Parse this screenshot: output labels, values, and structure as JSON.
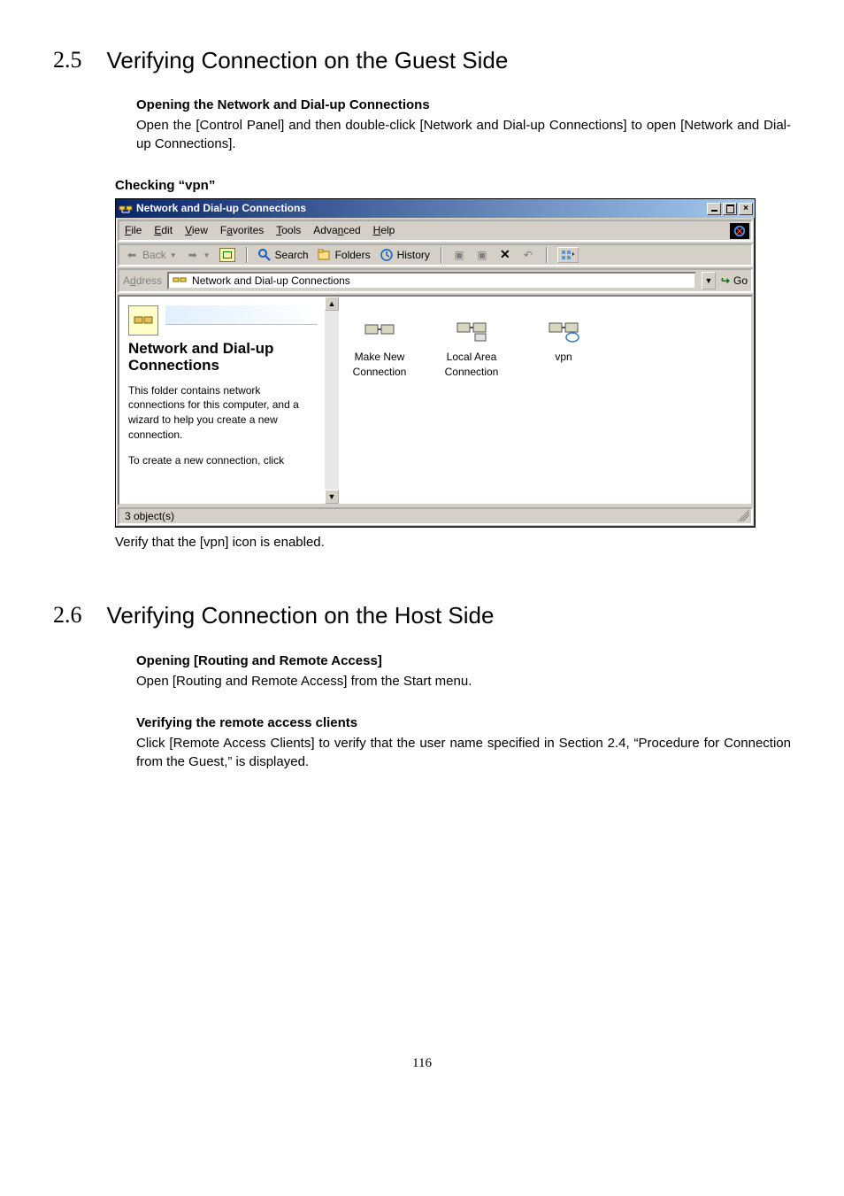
{
  "section25": {
    "number": "2.5",
    "title": "Verifying Connection on the Guest Side",
    "opening_heading": "Opening the Network and Dial-up Connections",
    "opening_body": "Open the [Control Panel] and then double-click [Network and Dial-up Connections] to open [Network and Dial-up Connections].",
    "checking_heading": "Checking “vpn”",
    "verify_text": "Verify that the [vpn] icon is enabled."
  },
  "window": {
    "title": "Network and Dial-up Connections",
    "menu": {
      "file": "File",
      "edit": "Edit",
      "view": "View",
      "favorites": "Favorites",
      "tools": "Tools",
      "advanced": "Advanced",
      "help": "Help"
    },
    "toolbar": {
      "back": "Back",
      "search": "Search",
      "folders": "Folders",
      "history": "History"
    },
    "address": {
      "label": "Address",
      "value": "Network and Dial-up Connections",
      "go": "Go"
    },
    "left": {
      "title": "Network and Dial-up Connections",
      "p1": "This folder contains network connections for this computer, and a wizard to help you create a new connection.",
      "p2": "To create a new connection, click"
    },
    "icons": {
      "makenew": "Make New Connection",
      "lan": "Local Area Connection",
      "vpn": "vpn"
    },
    "status": "3 object(s)"
  },
  "section26": {
    "number": "2.6",
    "title": "Verifying Connection on the Host Side",
    "opening_heading": "Opening [Routing and Remote Access]",
    "opening_body": "Open [Routing and Remote Access] from the Start menu.",
    "verify_heading": "Verifying the remote access clients",
    "verify_body": "Click [Remote Access Clients] to verify that the user name specified in Section 2.4, “Procedure for Connection from the Guest,” is displayed."
  },
  "page_number": "116"
}
